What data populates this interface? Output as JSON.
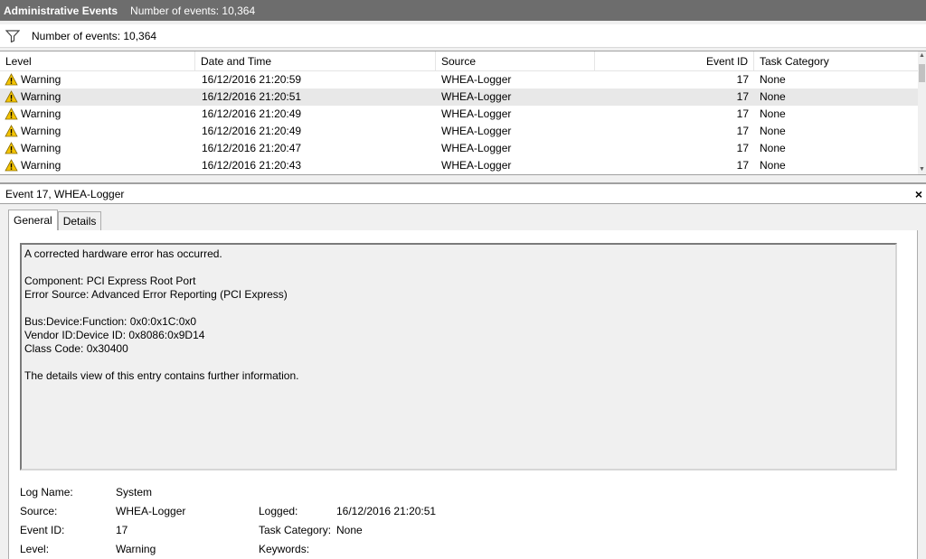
{
  "header": {
    "title": "Administrative Events",
    "event_count": "Number of events: 10,364"
  },
  "filter_bar": {
    "icon": "filter-icon",
    "event_count": "Number of events: 10,364"
  },
  "columns": {
    "level": "Level",
    "date": "Date and Time",
    "source": "Source",
    "event_id": "Event ID",
    "task": "Task Category"
  },
  "rows": [
    {
      "level": "Warning",
      "date": "16/12/2016 21:20:59",
      "source": "WHEA-Logger",
      "event_id": "17",
      "task": "None"
    },
    {
      "level": "Warning",
      "date": "16/12/2016 21:20:51",
      "source": "WHEA-Logger",
      "event_id": "17",
      "task": "None"
    },
    {
      "level": "Warning",
      "date": "16/12/2016 21:20:49",
      "source": "WHEA-Logger",
      "event_id": "17",
      "task": "None"
    },
    {
      "level": "Warning",
      "date": "16/12/2016 21:20:49",
      "source": "WHEA-Logger",
      "event_id": "17",
      "task": "None"
    },
    {
      "level": "Warning",
      "date": "16/12/2016 21:20:47",
      "source": "WHEA-Logger",
      "event_id": "17",
      "task": "None"
    },
    {
      "level": "Warning",
      "date": "16/12/2016 21:20:43",
      "source": "WHEA-Logger",
      "event_id": "17",
      "task": "None"
    }
  ],
  "detail": {
    "title": "Event 17, WHEA-Logger",
    "close": "×",
    "tabs": [
      "General",
      "Details"
    ],
    "description": {
      "line1": "A corrected hardware error has occurred.",
      "line2": "Component: PCI Express Root Port",
      "line3": "Error Source: Advanced Error Reporting (PCI Express)",
      "line4": "Bus:Device:Function: 0x0:0x1C:0x0",
      "line5": "Vendor ID:Device ID: 0x8086:0x9D14",
      "line6": "Class Code: 0x30400",
      "line7": "The details view of this entry contains further information."
    },
    "props": {
      "log_name_label": "Log Name:",
      "log_name_value": "System",
      "source_label": "Source:",
      "source_value": "WHEA-Logger",
      "logged_label": "Logged:",
      "logged_value": "16/12/2016 21:20:51",
      "event_id_label": "Event ID:",
      "event_id_value": "17",
      "task_label": "Task Category:",
      "task_value": "None",
      "level_label": "Level:",
      "level_value": "Warning",
      "keywords_label": "Keywords:"
    }
  },
  "colors": {
    "title_bar": "#6d6d6d",
    "warning_yellow": "#f4c400",
    "selected_row": "#e8e8e8"
  }
}
